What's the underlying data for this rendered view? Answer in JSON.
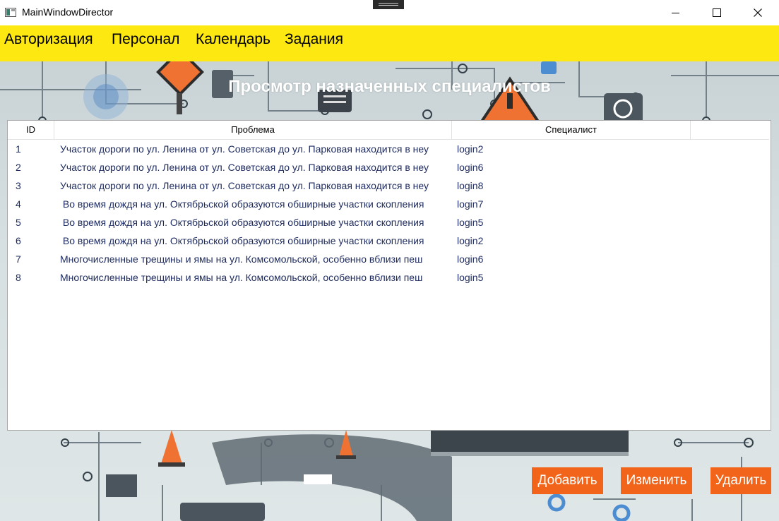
{
  "window": {
    "title": "MainWindowDirector"
  },
  "menu": {
    "items": [
      "Авторизация",
      "Персонал",
      "Календарь",
      "Задания"
    ]
  },
  "page": {
    "heading": "Просмотр назначенных специалистов"
  },
  "table": {
    "columns": [
      "ID",
      "Проблема",
      "Специалист"
    ],
    "rows": [
      {
        "id": "1",
        "problem": "Участок дороги по ул. Ленина от ул. Советская до ул. Парковая находится в неу",
        "specialist": "login2"
      },
      {
        "id": "2",
        "problem": "Участок дороги по ул. Ленина от ул. Советская до ул. Парковая находится в неу",
        "specialist": "login6"
      },
      {
        "id": "3",
        "problem": "Участок дороги по ул. Ленина от ул. Советская до ул. Парковая находится в неу",
        "specialist": "login8"
      },
      {
        "id": "4",
        "problem": " Во время дождя на ул. Октябрьской образуются обширные участки скопления",
        "specialist": "login7"
      },
      {
        "id": "5",
        "problem": " Во время дождя на ул. Октябрьской образуются обширные участки скопления",
        "specialist": "login5"
      },
      {
        "id": "6",
        "problem": " Во время дождя на ул. Октябрьской образуются обширные участки скопления",
        "specialist": "login2"
      },
      {
        "id": "7",
        "problem": "Многочисленные трещины и ямы на ул. Комсомольской, особенно вблизи пеш",
        "specialist": "login6"
      },
      {
        "id": "8",
        "problem": "Многочисленные трещины и ямы на ул. Комсомольской, особенно вблизи пеш",
        "specialist": "login5"
      }
    ]
  },
  "buttons": {
    "add": "Добавить",
    "edit": "Изменить",
    "delete": "Удалить"
  },
  "colors": {
    "menu_bg": "#fde812",
    "button_bg": "#f26419",
    "row_text": "#1d2a5e"
  },
  "icons": {
    "close": "close-icon",
    "maximize": "maximize-icon",
    "minimize": "minimize-icon",
    "app": "app-icon"
  }
}
